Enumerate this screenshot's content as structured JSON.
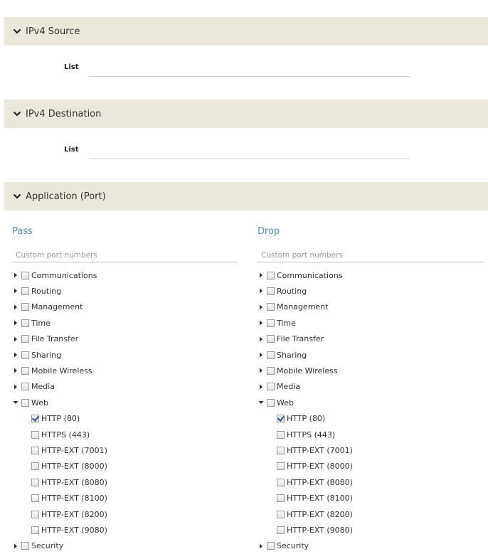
{
  "sections": {
    "ipv4_source": {
      "title": "IPv4 Source",
      "list_label": "List",
      "list_value": ""
    },
    "ipv4_destination": {
      "title": "IPv4 Destination",
      "list_label": "List",
      "list_value": ""
    },
    "application": {
      "title": "Application (Port)"
    }
  },
  "pass": {
    "title": "Pass",
    "custom_placeholder": "Custom port numbers",
    "categories": [
      "Communications",
      "Routing",
      "Management",
      "Time",
      "File Transfer",
      "Sharing",
      "Mobile Wireless",
      "Media"
    ],
    "web": {
      "label": "Web",
      "checked": false,
      "expanded": true
    },
    "web_children": [
      {
        "label": "HTTP (80)",
        "checked": true
      },
      {
        "label": "HTTPS (443)",
        "checked": false
      },
      {
        "label": "HTTP-EXT (7001)",
        "checked": false
      },
      {
        "label": "HTTP-EXT (8000)",
        "checked": false
      },
      {
        "label": "HTTP-EXT (8080)",
        "checked": false
      },
      {
        "label": "HTTP-EXT (8100)",
        "checked": false
      },
      {
        "label": "HTTP-EXT (8200)",
        "checked": false
      },
      {
        "label": "HTTP-EXT (9080)",
        "checked": false
      }
    ],
    "last_category": "Security"
  },
  "drop": {
    "title": "Drop",
    "custom_placeholder": "Custom port numbers",
    "categories": [
      "Communications",
      "Routing",
      "Management",
      "Time",
      "File Transfer",
      "Sharing",
      "Mobile Wireless",
      "Media"
    ],
    "web": {
      "label": "Web",
      "checked": false,
      "expanded": true
    },
    "web_children": [
      {
        "label": "HTTP (80)",
        "checked": true
      },
      {
        "label": "HTTPS (443)",
        "checked": false
      },
      {
        "label": "HTTP-EXT (7001)",
        "checked": false
      },
      {
        "label": "HTTP-EXT (8000)",
        "checked": false
      },
      {
        "label": "HTTP-EXT (8080)",
        "checked": false
      },
      {
        "label": "HTTP-EXT (8100)",
        "checked": false
      },
      {
        "label": "HTTP-EXT (8200)",
        "checked": false
      },
      {
        "label": "HTTP-EXT (9080)",
        "checked": false
      }
    ],
    "last_category": "Security"
  },
  "colors": {
    "header_bg": "#ebe7da",
    "column_title": "#5a8db5"
  }
}
